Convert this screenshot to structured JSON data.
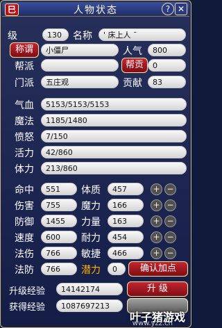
{
  "window": {
    "title": "人物状态",
    "help": "?",
    "close": "✕"
  },
  "basic": {
    "level_label": "级",
    "level_value": "130",
    "name_label": "名称",
    "name_value": "' 床上人 ¯",
    "title_btn": "称谓",
    "title_value": "小僵尸",
    "pop_label": "人气",
    "pop_value": "800",
    "gang_label": "帮派",
    "gang_value": "",
    "gang_contrib_btn": "帮贡",
    "gang_contrib_value": "0",
    "sect_label": "门派",
    "sect_value": "五庄观",
    "devote_label": "贡献",
    "devote_value": "83"
  },
  "vitals": [
    {
      "label": "气血",
      "value": "5153/5153/5153"
    },
    {
      "label": "魔法",
      "value": "1185/1480"
    },
    {
      "label": "愤怒",
      "value": "7/150"
    },
    {
      "label": "活力",
      "value": "42/860"
    },
    {
      "label": "体力",
      "value": "213/860"
    }
  ],
  "stats_left": [
    {
      "label": "命中",
      "value": "551"
    },
    {
      "label": "伤害",
      "value": "755"
    },
    {
      "label": "防御",
      "value": "1455"
    },
    {
      "label": "速度",
      "value": "600"
    },
    {
      "label": "法伤",
      "value": "766"
    },
    {
      "label": "法防",
      "value": "766"
    }
  ],
  "stats_right": [
    {
      "label": "体质",
      "value": "457"
    },
    {
      "label": "魔力",
      "value": "166"
    },
    {
      "label": "力量",
      "value": "163"
    },
    {
      "label": "耐力",
      "value": "454"
    },
    {
      "label": "敏捷",
      "value": "466"
    }
  ],
  "potential": {
    "label": "潜力",
    "value": "0",
    "confirm_btn": "确认加点"
  },
  "exp": {
    "upgrade_label": "升级经验",
    "upgrade_value": "14142174",
    "upgrade_btn": "升 级",
    "gained_label": "获得经验",
    "gained_value": "1087697213"
  },
  "watermark": {
    "text": "叶子猪游戏",
    "url": "www.yzz.cn"
  }
}
